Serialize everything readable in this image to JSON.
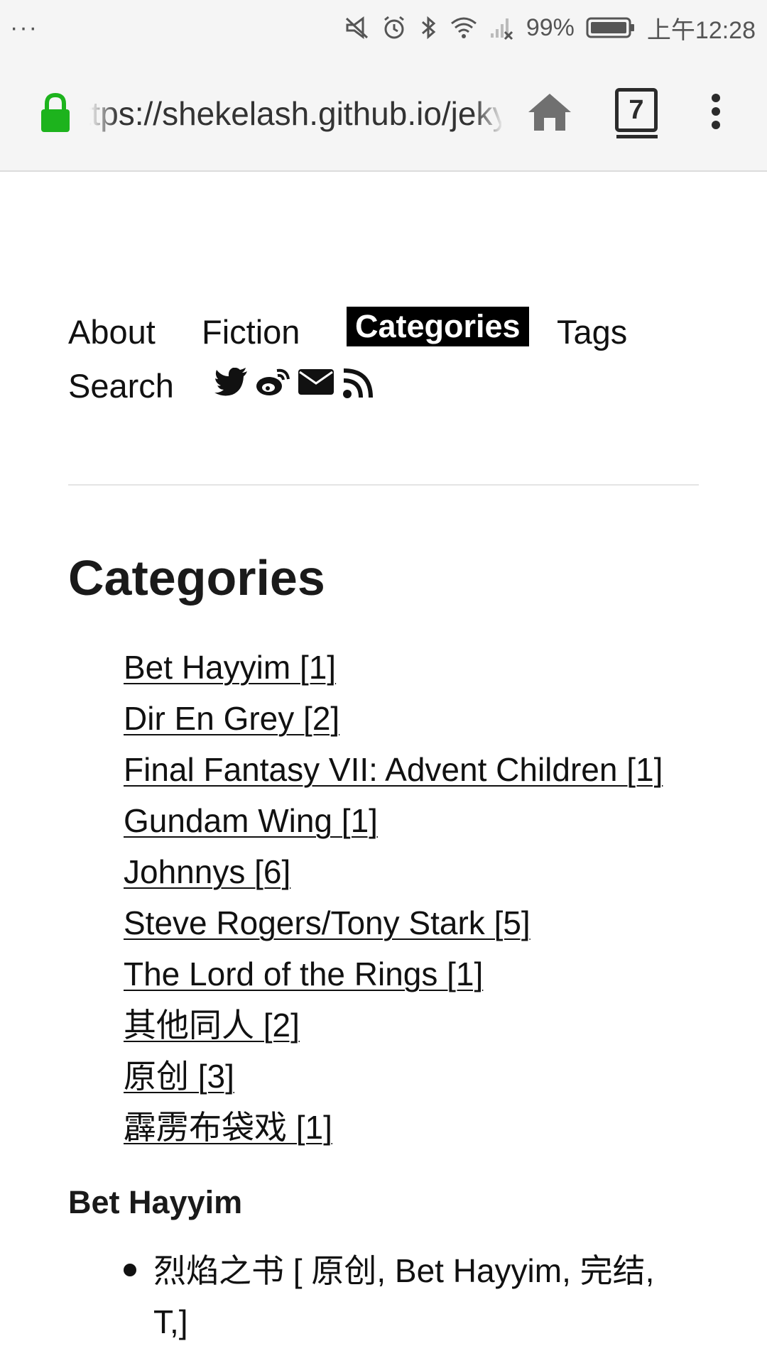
{
  "status_bar": {
    "left_dots": "···",
    "battery_percent": "99%",
    "time": "上午12:28"
  },
  "browser": {
    "url": "https://shekelash.github.io/jekyll",
    "tab_count": "7",
    "icons": [
      "lock-icon",
      "home-icon",
      "tabs-icon",
      "more-vert-icon"
    ],
    "lock_color": "#1db31d"
  },
  "nav": {
    "items": [
      {
        "label": "About"
      },
      {
        "label": "Fiction"
      },
      {
        "label": "Categories",
        "active": true
      },
      {
        "label": "Tags"
      },
      {
        "label": "Search"
      }
    ],
    "social_icons": [
      "twitter-icon",
      "weibo-icon",
      "email-icon",
      "rss-icon"
    ]
  },
  "page": {
    "title": "Categories",
    "categories": [
      {
        "label": "Bet Hayyim [1]"
      },
      {
        "label": "Dir En Grey [2]"
      },
      {
        "label": "Final Fantasy VII: Advent Children [1]"
      },
      {
        "label": "Gundam Wing [1]"
      },
      {
        "label": "Johnnys [6]"
      },
      {
        "label": "Steve Rogers/Tony Stark [5]"
      },
      {
        "label": "The Lord of the Rings [1]"
      },
      {
        "label": "其他同人 [2]"
      },
      {
        "label": "原创 [3]"
      },
      {
        "label": "霹雳布袋戏 [1]"
      }
    ],
    "sections": [
      {
        "heading": "Bet Hayyim",
        "posts": [
          {
            "text": "烈焰之书  [ 原创, Bet Hayyim, 完结, T,]"
          }
        ]
      }
    ]
  }
}
